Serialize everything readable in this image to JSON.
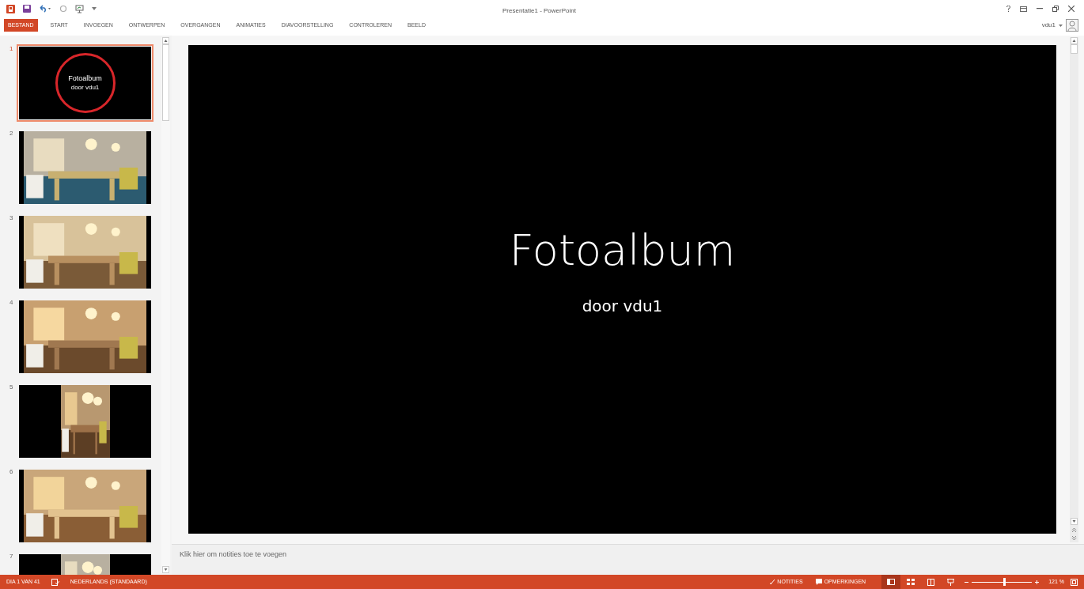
{
  "window": {
    "title": "Presentatie1 - PowerPoint",
    "user": "vdu1"
  },
  "ribbon_tabs": [
    {
      "label": "BESTAND",
      "selected": true
    },
    {
      "label": "START",
      "selected": false
    },
    {
      "label": "INVOEGEN",
      "selected": false
    },
    {
      "label": "ONTWERPEN",
      "selected": false
    },
    {
      "label": "OVERGANGEN",
      "selected": false
    },
    {
      "label": "ANIMATIES",
      "selected": false
    },
    {
      "label": "DIAVOORSTELLING",
      "selected": false
    },
    {
      "label": "CONTROLEREN",
      "selected": false
    },
    {
      "label": "BEELD",
      "selected": false
    }
  ],
  "slides": [
    {
      "number": "1",
      "kind": "title",
      "selected": true,
      "title": "Fotoalbum",
      "subtitle": "door vdu1",
      "highlighted": true
    },
    {
      "number": "2",
      "kind": "picture",
      "selected": false
    },
    {
      "number": "3",
      "kind": "picture",
      "selected": false
    },
    {
      "number": "4",
      "kind": "picture",
      "selected": false
    },
    {
      "number": "5",
      "kind": "portrait",
      "selected": false
    },
    {
      "number": "6",
      "kind": "picture",
      "selected": false
    },
    {
      "number": "7",
      "kind": "portrait",
      "selected": false
    }
  ],
  "current_slide": {
    "title": "Fotoalbum",
    "subtitle": "door vdu1"
  },
  "notes": {
    "placeholder": "Klik hier om notities toe te voegen"
  },
  "status_bar": {
    "slide_position": "DIA 1 VAN 41",
    "language": "NEDERLANDS (STANDAARD)",
    "notes_button": "NOTITIES",
    "comments_button": "OPMERKINGEN",
    "zoom": {
      "level": 0.55,
      "reading": "121 %"
    }
  }
}
